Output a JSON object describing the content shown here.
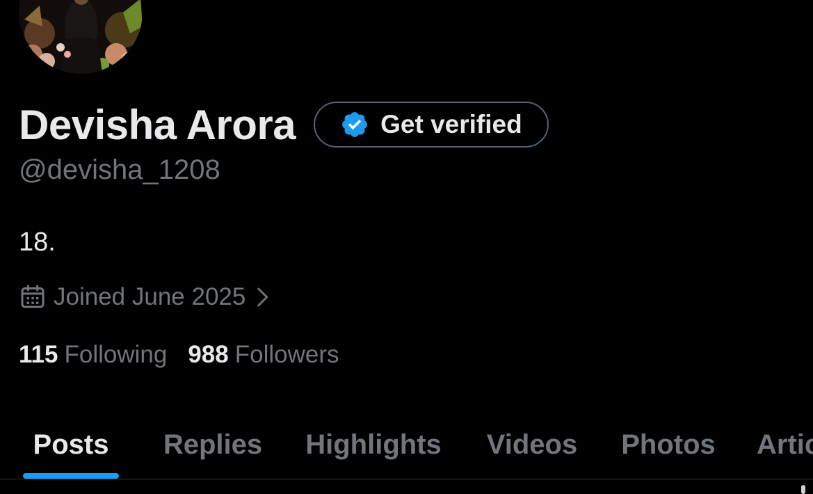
{
  "profile": {
    "display_name": "Devisha Arora",
    "handle": "@devisha_1208",
    "bio": "18.",
    "joined": "Joined June 2025",
    "verify_button_label": "Get verified"
  },
  "stats": {
    "following_count": "115",
    "following_label": "Following",
    "followers_count": "988",
    "followers_label": "Followers"
  },
  "tabs": [
    {
      "label": "Posts",
      "active": true
    },
    {
      "label": "Replies",
      "active": false
    },
    {
      "label": "Highlights",
      "active": false
    },
    {
      "label": "Videos",
      "active": false
    },
    {
      "label": "Photos",
      "active": false
    },
    {
      "label": "Articles",
      "active": false
    }
  ],
  "icons": {
    "verified": "verified-badge-icon",
    "calendar": "calendar-icon",
    "chevron": "chevron-right-icon"
  },
  "colors": {
    "background": "#000000",
    "primary_text": "#e7e9ea",
    "secondary_text": "#71767b",
    "accent": "#1d9bf0",
    "border": "#536471",
    "divider": "#2f3336"
  }
}
